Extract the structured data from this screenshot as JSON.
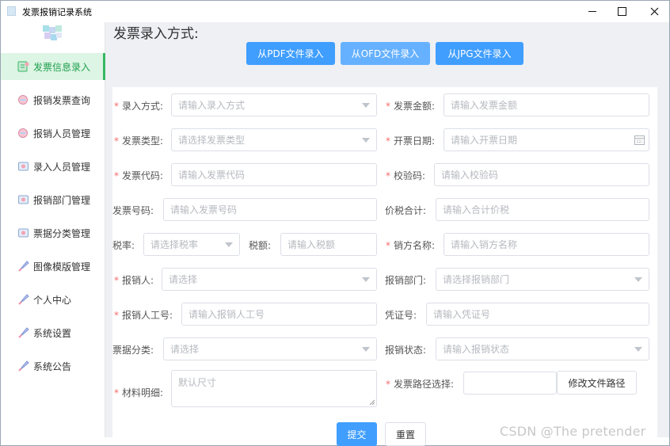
{
  "window": {
    "title": "发票报销记录系统"
  },
  "sidebar": {
    "items": [
      {
        "label": "发票信息录入",
        "active": true
      },
      {
        "label": "报销发票查询"
      },
      {
        "label": "报销人员管理"
      },
      {
        "label": "录入人员管理"
      },
      {
        "label": "报销部门管理"
      },
      {
        "label": "票据分类管理"
      },
      {
        "label": "图像模版管理"
      },
      {
        "label": "个人中心"
      },
      {
        "label": "系统设置"
      },
      {
        "label": "系统公告"
      }
    ]
  },
  "main": {
    "title": "发票录入方式:",
    "import_buttons": [
      "从PDF文件录入",
      "从OFD文件录入",
      "从JPG文件录入"
    ]
  },
  "form": {
    "entry_method": {
      "label": "录入方式:",
      "placeholder": "请输入录入方式"
    },
    "amount": {
      "label": "发票金额:",
      "placeholder": "请输入发票金额"
    },
    "invoice_type": {
      "label": "发票类型:",
      "placeholder": "请选择发票类型"
    },
    "issue_date": {
      "label": "开票日期:",
      "placeholder": "请输入开票日期"
    },
    "invoice_code": {
      "label": "发票代码:",
      "placeholder": "请输入发票代码"
    },
    "check_code": {
      "label": "校验码:",
      "placeholder": "请输入校验码"
    },
    "invoice_number": {
      "label": "发票号码:",
      "placeholder": "请输入发票号码"
    },
    "total_with_tax": {
      "label": "价税合计:",
      "placeholder": "请输入合计价税"
    },
    "tax_rate": {
      "label": "税率:",
      "placeholder": "请选择税率"
    },
    "tax_amount": {
      "label": "税额:",
      "placeholder": "请输入税额"
    },
    "seller_name": {
      "label": "销方名称:",
      "placeholder": "请输入销方名称"
    },
    "reimburser": {
      "label": "报销人:",
      "placeholder": "请选择"
    },
    "department": {
      "label": "报销部门:",
      "placeholder": "请选择报销部门"
    },
    "employee_id": {
      "label": "报销人工号:",
      "placeholder": "请输入报销人工号"
    },
    "voucher_number": {
      "label": "凭证号:",
      "placeholder": "请输入凭证号"
    },
    "category": {
      "label": "票据分类:",
      "placeholder": "请选择"
    },
    "status": {
      "label": "报销状态:",
      "placeholder": "请输入报销状态"
    },
    "details": {
      "label": "材料明细:",
      "placeholder": "默认尺寸"
    },
    "file_path": {
      "label": "发票路径选择:",
      "value": ""
    },
    "change_path_button": "修改文件路径",
    "submit_button": "提交",
    "reset_button": "重置",
    "required_mark": "*"
  },
  "watermark": "CSDN @The  pretender",
  "colors": {
    "primary": "#409eff",
    "active_nav": "#20a04f",
    "required": "#f56c6c"
  }
}
